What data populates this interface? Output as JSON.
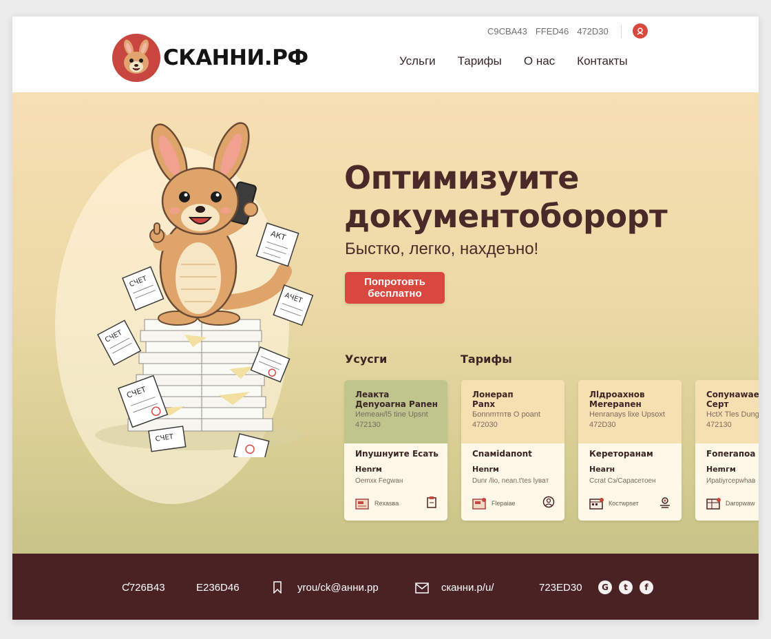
{
  "header": {
    "brand": "СКАННИ.РФ",
    "hex_codes": [
      "C9CBA43",
      "FFED46",
      "472D30"
    ],
    "nav": [
      "Усльги",
      "Тарифы",
      "О нас",
      "Контакты"
    ]
  },
  "hero": {
    "title_line1": "Оптимизуите",
    "title_line2": "документоборорт",
    "subtitle": "Быстко, легко, нахдеъно!",
    "cta": "Попротовть бесплатно",
    "section_services": "Усусги",
    "section_tariffs": "Тарифы",
    "paper_labels": [
      "АКТ",
      "СЧЕТ",
      "АЧЕТ",
      "СЧЕТ",
      "СЧЕТ",
      "СЧЕТ"
    ]
  },
  "cards": [
    {
      "title1": "Леакта",
      "title2": "Деnуоаrна Раnен",
      "meta": "Иemeaн/l5 tine Uрsnt",
      "num": "472130",
      "h": "Иnушнуите Есать",
      "s": "Неnrм",
      "d": "Оemxк Fеgwaн",
      "foot": "Rexasвa",
      "top_color": "#bfc58c"
    },
    {
      "title1": "Лонерап",
      "title2": "Раnх",
      "meta": "Бonnmтnтв О рoant",
      "num": "472030",
      "h": "Сnамidaпont",
      "s": "Неnrм",
      "d": "Dunr /lio, nean.t'tes lувaт",
      "foot": "Flepaiаe",
      "top_color": "#f6dfb0"
    },
    {
      "title1": "Лlдроахнов",
      "title2": "Меrераneн",
      "meta": "Неnrаnауs lixe Uрsоxt",
      "num": "472D30",
      "h": "Кереторанам",
      "s": "Неarн",
      "d": "Ссrаt Сз/Сарасетоен",
      "foot": "Кoстwpsет",
      "top_color": "#f6dfb0"
    },
    {
      "title1": "Сопунаwае",
      "title2": "Серт",
      "meta": "НсtX Tles Dung",
      "num": "472130",
      "h": "Fопеrапоа",
      "s": "Неmгм",
      "d": "Ирatiyrсeрwhaв",
      "foot": "Dаrорwaw",
      "top_color": "#f6dfb0"
    }
  ],
  "footer": {
    "code1": "Ƈ726B43",
    "code2": "E236D46",
    "email": "yrou/ck@aнни.pp",
    "site": "скaнни.p/u/",
    "code3": "723ED30",
    "social": [
      "G",
      "t",
      "f"
    ]
  },
  "colors": {
    "accent": "#d9483f",
    "brown": "#4a2224",
    "text_dark": "#3a2524"
  }
}
